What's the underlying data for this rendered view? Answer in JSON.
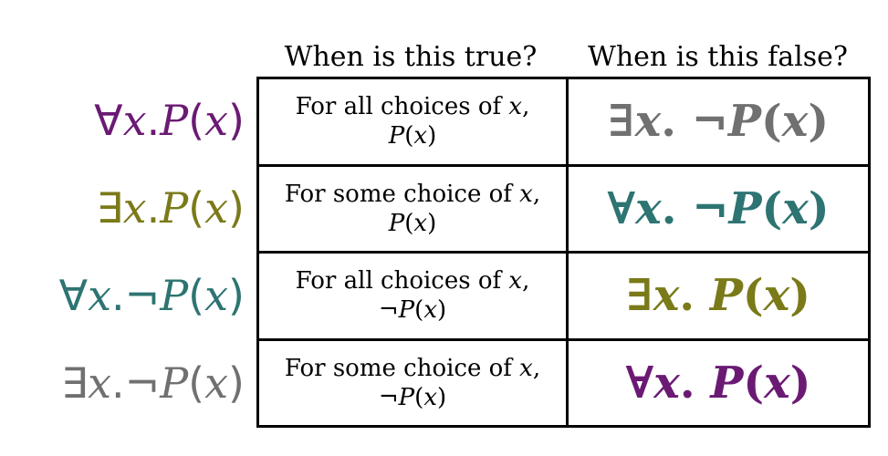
{
  "colors": {
    "purple": "#6b1a74",
    "olive": "#7a7a19",
    "teal": "#2d7472",
    "gray": "#707070"
  },
  "headers": {
    "true_col": "When is this true?",
    "false_col": "When is this false?"
  },
  "rows": [
    {
      "label": {
        "q": "∀",
        "var": "x",
        "dot": ". ",
        "neg": "",
        "pred": "P",
        "open": "(",
        "arg": "x",
        "close": ")"
      },
      "label_color": "purple",
      "true_line1": {
        "text": "For all choices of ",
        "var": "x",
        "comma": ","
      },
      "true_line2": {
        "neg": "",
        "pred": "P",
        "open": "(",
        "arg": "x",
        "close": ")"
      },
      "false": {
        "q": "∃",
        "var": "x",
        "dot": ". ",
        "neg": "¬",
        "pred": "P",
        "open": "(",
        "arg": "x",
        "close": ")"
      },
      "false_color": "gray"
    },
    {
      "label": {
        "q": "∃",
        "var": "x",
        "dot": ". ",
        "neg": "",
        "pred": "P",
        "open": "(",
        "arg": "x",
        "close": ")"
      },
      "label_color": "olive",
      "true_line1": {
        "text": "For some choice of ",
        "var": "x",
        "comma": ","
      },
      "true_line2": {
        "neg": "",
        "pred": "P",
        "open": "(",
        "arg": "x",
        "close": ")"
      },
      "false": {
        "q": "∀",
        "var": "x",
        "dot": ". ",
        "neg": "¬",
        "pred": "P",
        "open": "(",
        "arg": "x",
        "close": ")"
      },
      "false_color": "teal"
    },
    {
      "label": {
        "q": "∀",
        "var": "x",
        "dot": ". ",
        "neg": "¬",
        "pred": "P",
        "open": "(",
        "arg": "x",
        "close": ")"
      },
      "label_color": "teal",
      "true_line1": {
        "text": "For all choices of ",
        "var": "x",
        "comma": ","
      },
      "true_line2": {
        "neg": "¬",
        "pred": "P",
        "open": "(",
        "arg": "x",
        "close": ")"
      },
      "false": {
        "q": "∃",
        "var": "x",
        "dot": ". ",
        "neg": "",
        "pred": "P",
        "open": "(",
        "arg": "x",
        "close": ")"
      },
      "false_color": "olive"
    },
    {
      "label": {
        "q": "∃",
        "var": "x",
        "dot": ". ",
        "neg": "¬",
        "pred": "P",
        "open": "(",
        "arg": "x",
        "close": ")"
      },
      "label_color": "gray",
      "true_line1": {
        "text": "For some choice of ",
        "var": "x",
        "comma": ","
      },
      "true_line2": {
        "neg": "¬",
        "pred": "P",
        "open": "(",
        "arg": "x",
        "close": ")"
      },
      "false": {
        "q": "∀",
        "var": "x",
        "dot": ". ",
        "neg": "",
        "pred": "P",
        "open": "(",
        "arg": "x",
        "close": ")"
      },
      "false_color": "purple"
    }
  ]
}
